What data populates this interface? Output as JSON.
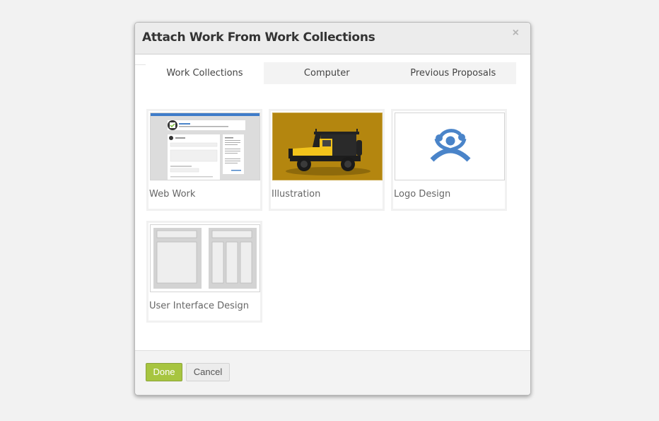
{
  "dialog": {
    "title": "Attach Work From Work Collections",
    "close_icon": "×"
  },
  "tabs": [
    {
      "label": "Work Collections",
      "active": true
    },
    {
      "label": "Computer",
      "active": false
    },
    {
      "label": "Previous Proposals",
      "active": false
    }
  ],
  "collections": [
    {
      "label": "Web Work",
      "thumbnail": "web-form-screenshot"
    },
    {
      "label": "Illustration",
      "thumbnail": "yellow-jeep-illustration"
    },
    {
      "label": "Logo Design",
      "thumbnail": "blue-figure-logo"
    },
    {
      "label": "User Interface Design",
      "thumbnail": "wireframe-layouts"
    }
  ],
  "colors": {
    "accent_green": "#a7c540",
    "logo_blue": "#4a84c9",
    "illustration_bg": "#b4860f",
    "jeep_yellow": "#f2c31b",
    "web_header_blue": "#3f7cc9"
  },
  "footer": {
    "done_label": "Done",
    "cancel_label": "Cancel"
  }
}
